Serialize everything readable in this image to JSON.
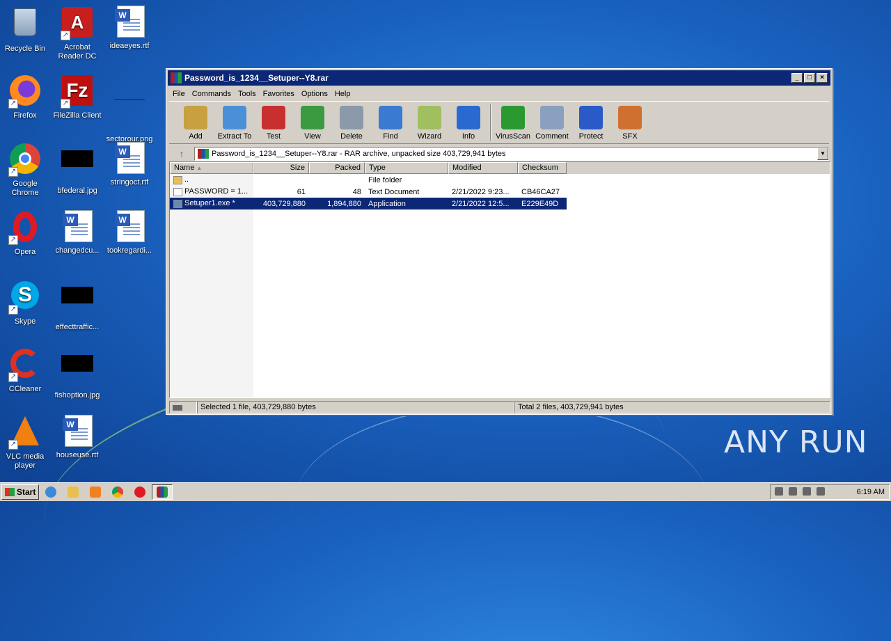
{
  "desktop": {
    "icons": [
      {
        "label": "Recycle Bin",
        "icon": "recycle-bin-icon"
      },
      {
        "label": "Acrobat Reader DC",
        "icon": "acrobat-icon"
      },
      {
        "label": "ideaeyes.rtf",
        "icon": "word-document-icon"
      },
      {
        "label": "Firefox",
        "icon": "firefox-icon"
      },
      {
        "label": "FileZilla Client",
        "icon": "filezilla-icon"
      },
      {
        "label": "sectorour.png",
        "icon": "image-file-icon"
      },
      {
        "label": "Google Chrome",
        "icon": "chrome-icon"
      },
      {
        "label": "bfederal.jpg",
        "icon": "image-file-icon"
      },
      {
        "label": "stringoct.rtf",
        "icon": "word-document-icon"
      },
      {
        "label": "Opera",
        "icon": "opera-icon"
      },
      {
        "label": "changedcu...",
        "icon": "word-document-icon"
      },
      {
        "label": "tookregardi...",
        "icon": "word-document-icon"
      },
      {
        "label": "Skype",
        "icon": "skype-icon"
      },
      {
        "label": "effecttraffic...",
        "icon": "image-file-icon"
      },
      {
        "label": "CCleaner",
        "icon": "ccleaner-icon"
      },
      {
        "label": "fishoption.jpg",
        "icon": "image-file-icon"
      },
      {
        "label": "VLC media player",
        "icon": "vlc-icon"
      },
      {
        "label": "houseuse.rtf",
        "icon": "word-document-icon"
      }
    ]
  },
  "window": {
    "title": "Password_is_1234__Setuper--Y8.rar",
    "minimize": "_",
    "maximize": "□",
    "close": "×",
    "menu": [
      "File",
      "Commands",
      "Tools",
      "Favorites",
      "Options",
      "Help"
    ],
    "toolbar": [
      {
        "label": "Add",
        "icon": "add-icon",
        "color": "#c8a040"
      },
      {
        "label": "Extract To",
        "icon": "extract-folder-icon",
        "color": "#4a90d8"
      },
      {
        "label": "Test",
        "icon": "test-clipboard-icon",
        "color": "#c83030"
      },
      {
        "label": "View",
        "icon": "view-book-icon",
        "color": "#3a9a40"
      },
      {
        "label": "Delete",
        "icon": "delete-trash-icon",
        "color": "#8a9aa8"
      },
      {
        "label": "Find",
        "icon": "find-magnifier-icon",
        "color": "#3a7ad0"
      },
      {
        "label": "Wizard",
        "icon": "wizard-wand-icon",
        "color": "#a0c060"
      },
      {
        "label": "Info",
        "icon": "info-icon",
        "color": "#2a6ad0"
      },
      {
        "label": "VirusScan",
        "icon": "virus-scan-icon",
        "color": "#2a9a30"
      },
      {
        "label": "Comment",
        "icon": "comment-icon",
        "color": "#8aa0c0"
      },
      {
        "label": "Protect",
        "icon": "protect-shield-icon",
        "color": "#2a5ac8"
      },
      {
        "label": "SFX",
        "icon": "sfx-icon",
        "color": "#d07030"
      }
    ],
    "path": "Password_is_1234__Setuper--Y8.rar - RAR archive, unpacked size 403,729,941 bytes",
    "columns": [
      "Name",
      "Size",
      "Packed",
      "Type",
      "Modified",
      "Checksum"
    ],
    "rows": [
      {
        "name": "..",
        "size": "",
        "packed": "",
        "type": "File folder",
        "modified": "",
        "checksum": "",
        "icon": "folder-icon",
        "selected": false
      },
      {
        "name": "PASSWORD = 1...",
        "size": "61",
        "packed": "48",
        "type": "Text Document",
        "modified": "2/21/2022 9:23...",
        "checksum": "CB46CA27",
        "icon": "text-file-icon",
        "selected": false
      },
      {
        "name": "Setuper1.exe *",
        "size": "403,729,880",
        "packed": "1,894,880",
        "type": "Application",
        "modified": "2/21/2022 12:5...",
        "checksum": "E229E49D",
        "icon": "exe-file-icon",
        "selected": true
      }
    ],
    "status_left": "Selected 1 file, 403,729,880 bytes",
    "status_right": "Total 2 files, 403,729,941 bytes"
  },
  "taskbar": {
    "start": "Start",
    "clock": "6:19 AM"
  },
  "watermark": "ANY RUN"
}
